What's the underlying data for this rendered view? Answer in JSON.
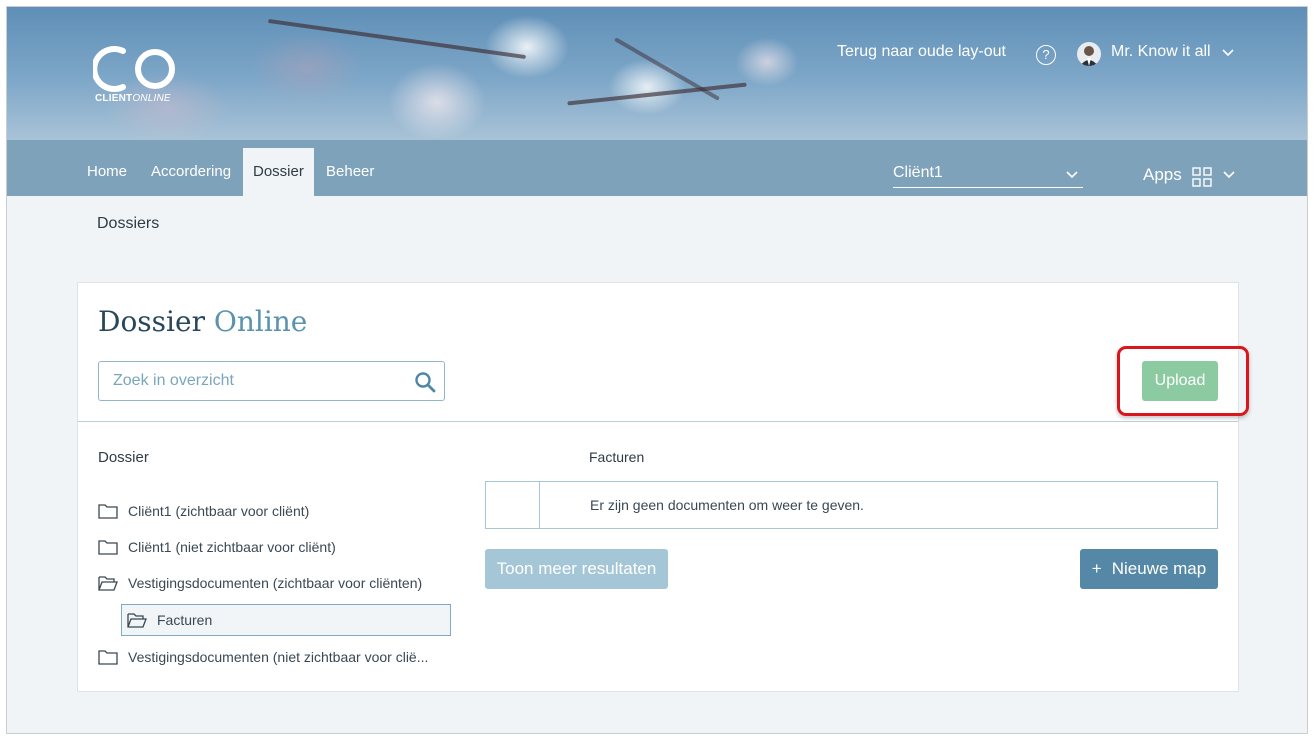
{
  "header": {
    "logo_text_bold": "CLIENT",
    "logo_text_italic": "ONLINE",
    "old_layout_link": "Terug naar oude lay-out",
    "help_icon": "?",
    "user_name": "Mr. Know it all"
  },
  "nav": {
    "items": [
      {
        "label": "Home"
      },
      {
        "label": "Accordering"
      },
      {
        "label": "Dossier",
        "active": true
      },
      {
        "label": "Beheer"
      }
    ],
    "client_select": "Cliënt1",
    "apps_label": "Apps"
  },
  "breadcrumb": "Dossiers",
  "card": {
    "title_main": "Dossier",
    "title_accent": "Online",
    "search_placeholder": "Zoek in overzicht",
    "upload_label": "Upload",
    "tree_heading": "Dossier",
    "tree_items": [
      {
        "label": "Cliënt1 (zichtbaar voor cliënt)",
        "icon": "folder-icon"
      },
      {
        "label": "Cliënt1 (niet zichtbaar voor cliënt)",
        "icon": "folder-icon"
      },
      {
        "label": "Vestigingsdocumenten (zichtbaar voor cliënten)",
        "icon": "folder-open-icon"
      },
      {
        "label": "Facturen",
        "icon": "folder-open-icon",
        "selected": true
      },
      {
        "label": "Vestigingsdocumenten (niet zichtbaar voor cliё...",
        "icon": "folder-icon"
      }
    ],
    "files_heading": "Facturen",
    "empty_message": "Er zijn geen documenten om weer te geven.",
    "more_results_label": "Toon meer resultaten",
    "new_map_label": "Nieuwe map",
    "new_map_plus": "+"
  },
  "colors": {
    "nav_bg": "#6c96b2",
    "upload_green": "#8ccaa1",
    "new_map_blue": "#5587a6",
    "highlight_red": "#d9161c",
    "title_accent": "#5a93ad"
  }
}
